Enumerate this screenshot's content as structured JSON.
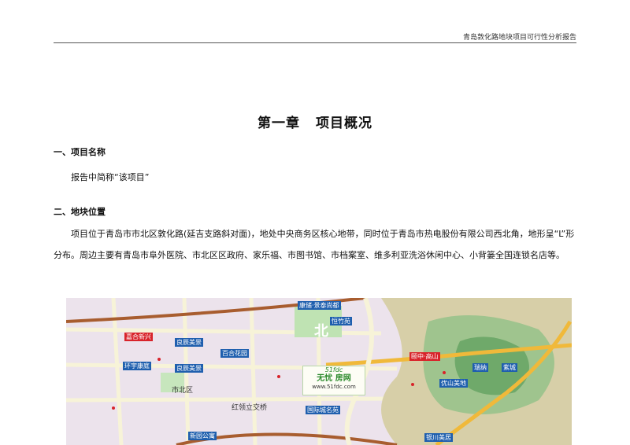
{
  "header": {
    "report_title": "青岛敦化路地块项目可行性分析报告"
  },
  "chapter": {
    "number": "第一章",
    "title": "项目概况"
  },
  "sections": [
    {
      "heading": "一、项目名称",
      "paragraph": "报告中简称“该项目”"
    },
    {
      "heading": "二、地块位置",
      "paragraph": "项目位于青岛市市北区敦化路(延吉支路斜对面)，地处中央商务区核心地带，同时位于青岛市热电股份有限公司西北角，地形呈“L”形分布。周边主要有青岛市阜外医院、市北区区政府、家乐福、市图书馆、市档案室、维多利亚洗浴休闲中心、小背篓全国连锁名店等。"
    }
  ],
  "map": {
    "labels": [
      {
        "text": "康储·景泰尚都",
        "style": "blue"
      },
      {
        "text": "恒竹苑",
        "style": "blue"
      },
      {
        "text": "嘉合新兴",
        "style": "red"
      },
      {
        "text": "良辰美景",
        "style": "blue"
      },
      {
        "text": "百合花园",
        "style": "blue"
      },
      {
        "text": "环宇康庭",
        "style": "blue"
      },
      {
        "text": "良辰美景",
        "style": "blue"
      },
      {
        "text": "颐中·高山",
        "style": "red"
      },
      {
        "text": "瑞纳",
        "style": "blue"
      },
      {
        "text": "紫城",
        "style": "blue"
      },
      {
        "text": "优山美地",
        "style": "blue"
      },
      {
        "text": "国际城名苑",
        "style": "blue"
      },
      {
        "text": "新园公寓",
        "style": "blue"
      },
      {
        "text": "银川美居",
        "style": "blue"
      },
      {
        "text": "市北区",
        "style": "plain"
      },
      {
        "text": "红领立交桥",
        "style": "plain"
      },
      {
        "text": "北",
        "style": "plain"
      }
    ],
    "watermark": {
      "top": "51fdc",
      "middle": "无忧 房网",
      "bottom": "www.51fdc.com"
    }
  }
}
